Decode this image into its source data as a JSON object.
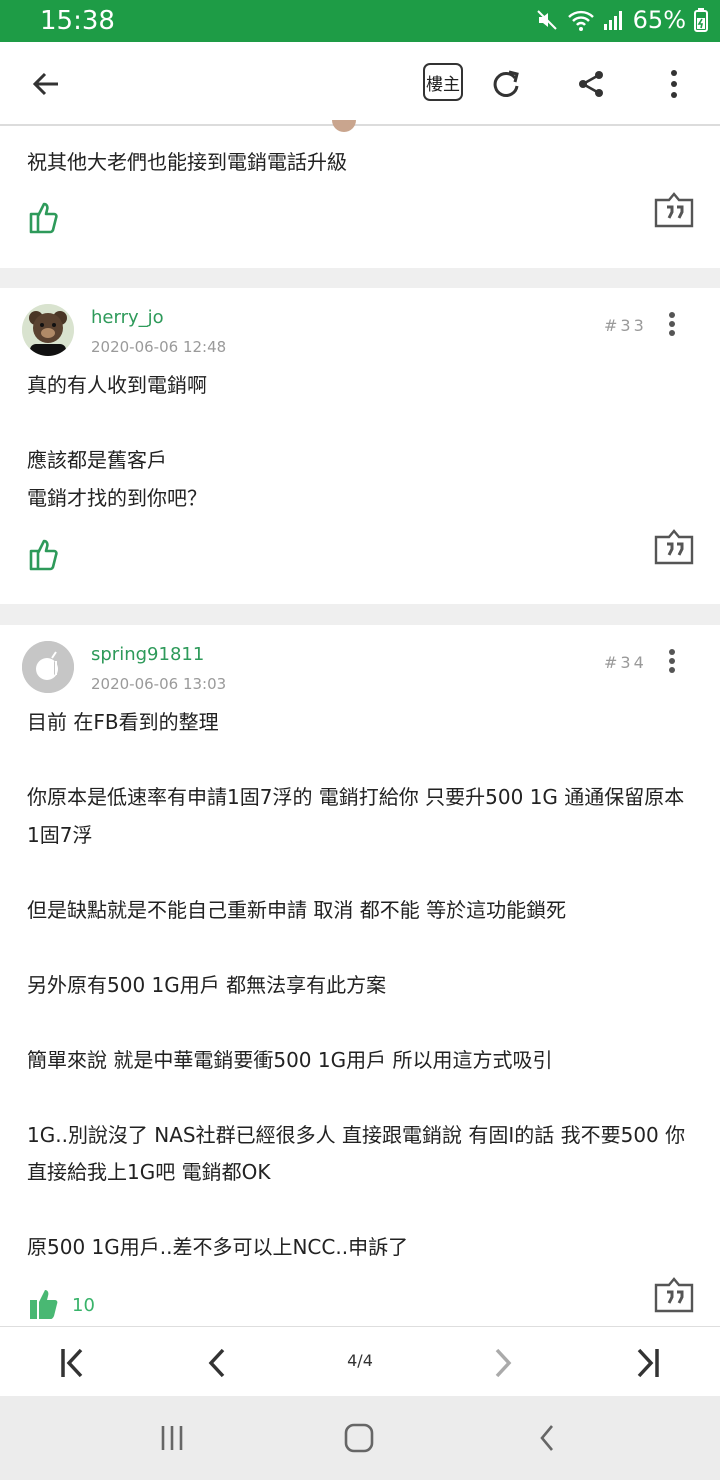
{
  "status_bar": {
    "time": "15:38",
    "battery": "65%"
  },
  "toolbar": {
    "op_label": "樓主"
  },
  "posts": [
    {
      "body": "祝其他大老們也能接到電銷電話升級"
    },
    {
      "author": "herry_jo",
      "time": "2020-06-06 12:48",
      "floor": "#33",
      "body": "真的有人收到電銷啊\n\n應該都是舊客戶\n電銷才找的到你吧？"
    },
    {
      "author": "spring91811",
      "time": "2020-06-06 13:03",
      "floor": "#34",
      "body": "目前 在FB看到的整理\n\n你原本是低速率有申請1固7浮的 電銷打給你 只要升500 1G 通通保留原本1固7浮\n\n但是缺點就是不能自己重新申請 取消 都不能 等於這功能鎖死\n\n另外原有500 1G用戶 都無法享有此方案\n\n簡單來說 就是中華電銷要衝500 1G用戶 所以用這方式吸引\n\n1G..別說沒了 NAS社群已經很多人 直接跟電銷說 有固I的話 我不要500 你直接給我上1G吧 電銷都OK\n\n原500 1G用戶..差不多可以上NCC..申訴了",
      "likes": "10"
    }
  ],
  "pagination": {
    "label": "4/4"
  },
  "colors": {
    "status_bar": "#1e9c46",
    "accent_green": "#2e9a5a"
  }
}
